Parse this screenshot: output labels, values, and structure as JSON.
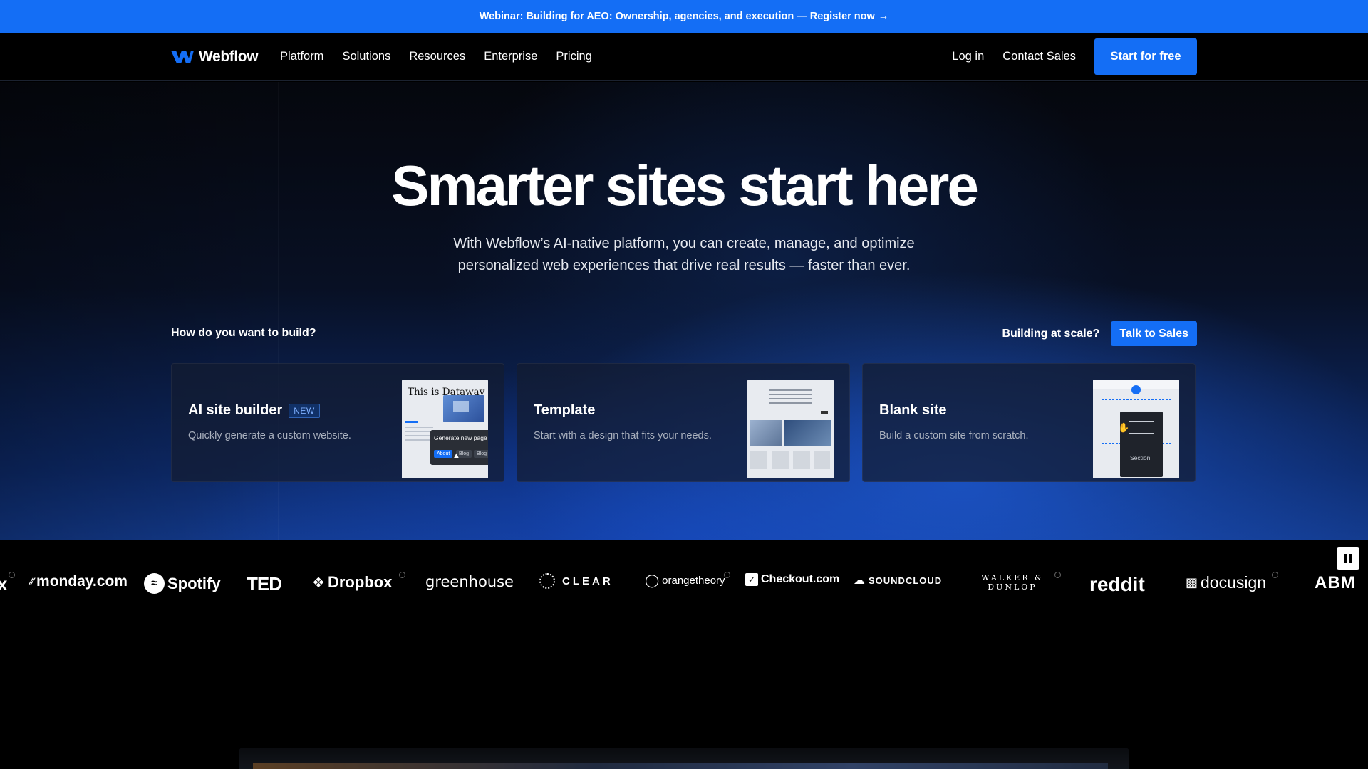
{
  "banner": {
    "text": "Webinar: Building for AEO: Ownership, agencies, and execution — Register now",
    "arrow": "→"
  },
  "nav": {
    "logo_text": "Webflow",
    "links": [
      "Platform",
      "Solutions",
      "Resources",
      "Enterprise",
      "Pricing"
    ],
    "login": "Log in",
    "contact": "Contact Sales",
    "cta": "Start for free"
  },
  "hero": {
    "title": "Smarter sites start here",
    "subtitle": "With Webflow’s AI-native platform, you can create, manage, and optimize personalized web experiences that drive real results — faster than ever.",
    "build_question": "How do you want to build?",
    "scale_question": "Building at scale?",
    "scale_cta": "Talk to Sales"
  },
  "cards": [
    {
      "title": "AI site builder",
      "badge": "NEW",
      "desc": "Quickly generate a custom website.",
      "thumb": {
        "headline": "This is Dataway",
        "popup": "Generate new page",
        "chips": [
          "About",
          "Blog",
          "Blog Post"
        ]
      }
    },
    {
      "title": "Template",
      "desc": "Start with a design that fits your needs."
    },
    {
      "title": "Blank site",
      "desc": "Build a custom site from scratch.",
      "thumb": {
        "label": "Section"
      }
    }
  ],
  "logos": [
    "monday.com",
    "Spotify",
    "TED",
    "Dropbox",
    "greenhouse",
    "CLEAR",
    "orangetheory",
    "Checkout.com",
    "SOUNDCLOUD",
    "WALKER & DUNLOP",
    "reddit",
    "docusign",
    "ABM"
  ],
  "colors": {
    "accent": "#146ef5",
    "background": "#000000"
  }
}
